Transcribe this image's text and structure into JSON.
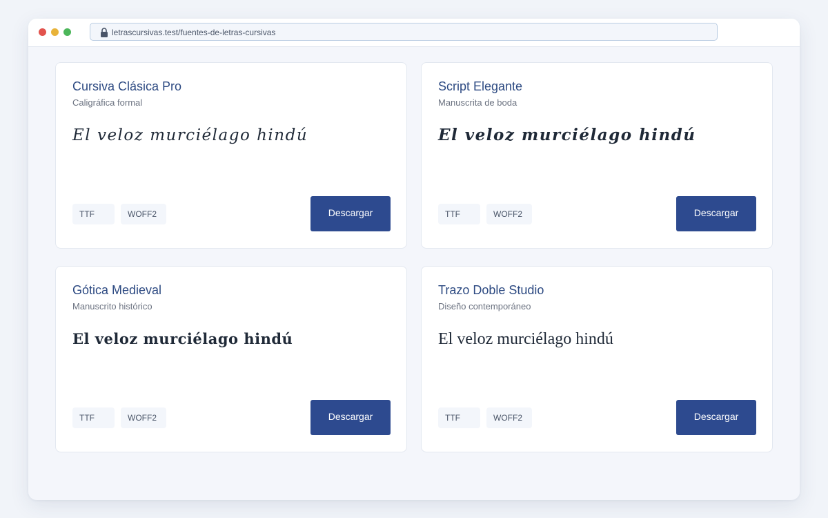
{
  "browser": {
    "url": "letrascursivas.test/fuentes-de-letras-cursivas",
    "lock_icon": "lock-icon"
  },
  "fonts": [
    {
      "name": "Cursiva Clásica Pro",
      "category": "Caligráfica formal",
      "sample": "El veloz murciélago hindú",
      "formats": [
        "TTF",
        "WOFF2"
      ],
      "download_label": "Descargar"
    },
    {
      "name": "Script Elegante",
      "category": "Manuscrita de boda",
      "sample": "El veloz murciélago hindú",
      "formats": [
        "TTF",
        "WOFF2"
      ],
      "download_label": "Descargar"
    },
    {
      "name": "Gótica Medieval",
      "category": "Manuscrito histórico",
      "sample": "El veloz murciélago hindú",
      "formats": [
        "TTF",
        "WOFF2"
      ],
      "download_label": "Descargar"
    },
    {
      "name": "Trazo Doble Studio",
      "category": "Diseño contemporáneo",
      "sample": "El veloz murciélago hindú",
      "formats": [
        "TTF",
        "WOFF2"
      ],
      "download_label": "Descargar"
    }
  ],
  "colors": {
    "accent": "#2d4a8f",
    "title": "#2d4a82",
    "background": "#f4f6fb",
    "window_close": "#e2534d",
    "window_minimize": "#e8b33a",
    "window_maximize": "#4cb65a"
  }
}
